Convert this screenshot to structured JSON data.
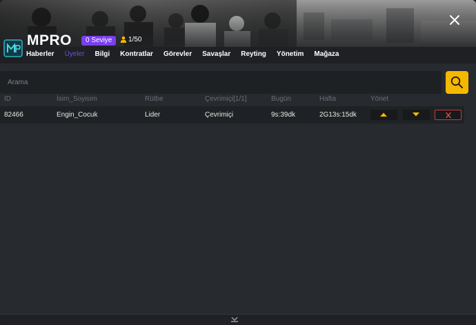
{
  "header": {
    "brand": "MPRO",
    "level_badge": "0 Seviye",
    "members_count": "1/50",
    "nav": [
      "Haberler",
      "Üyeler",
      "Bilgi",
      "Kontratlar",
      "Görevler",
      "Savaşlar",
      "Reyting",
      "Yönetim",
      "Mağaza"
    ],
    "active_tab": "Üyeler",
    "colors": {
      "accent": "#6a52e0",
      "badge": "#7b3ff0",
      "search_button": "#f5b800",
      "delete": "#d13a3a"
    }
  },
  "search": {
    "placeholder": "Arama",
    "value": ""
  },
  "table": {
    "headers": [
      "ID",
      "İsim_Soyisim",
      "Rütbe",
      "Çevrimiçi[1/1]",
      "Bugün",
      "Hafta",
      "Yönet"
    ],
    "rows": [
      {
        "id": "82466",
        "name": "Engin_Cocuk",
        "rank": "Lider",
        "status": "Çevrimiçi",
        "today": "9s:39dk",
        "week": "2G13s:15dk"
      }
    ]
  },
  "icons": [
    "close-icon",
    "logo-icon",
    "user-icon",
    "search-icon",
    "arrow-up-icon",
    "arrow-down-icon",
    "delete-x-icon",
    "collapse-chevron-icon"
  ]
}
